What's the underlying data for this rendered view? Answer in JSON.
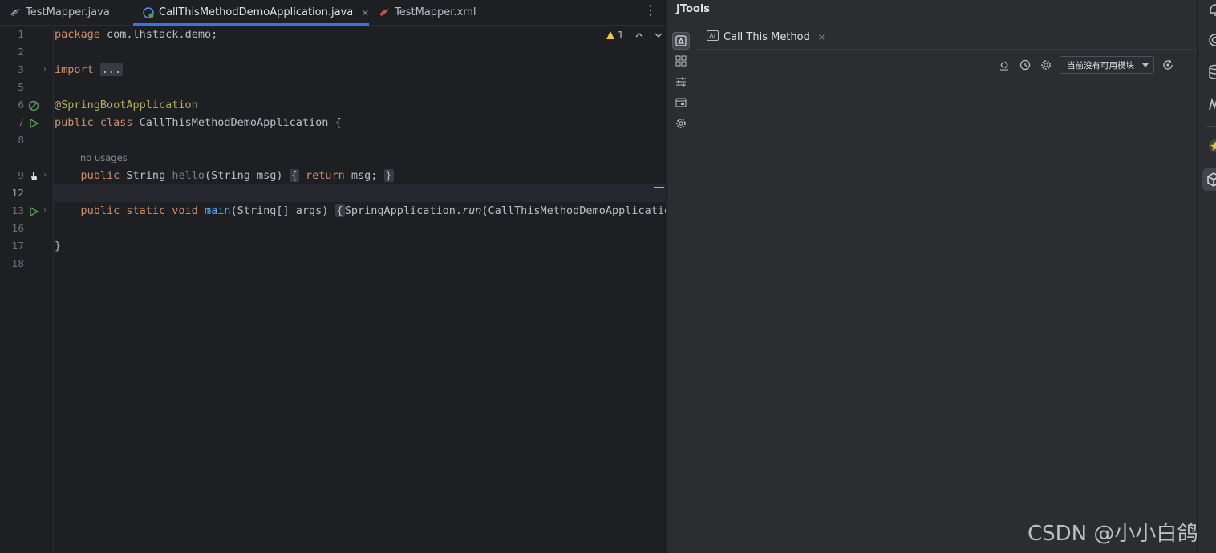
{
  "editor": {
    "tabs": [
      {
        "label": "TestMapper.java",
        "active": false
      },
      {
        "label": "CallThisMethodDemoApplication.java",
        "active": true
      },
      {
        "label": "TestMapper.xml",
        "active": false
      }
    ],
    "more_label": "⋮",
    "inspection": {
      "warning_count": "1"
    },
    "line_numbers": [
      "1",
      "2",
      "3",
      "5",
      "6",
      "7",
      "8",
      "9",
      "12",
      "13",
      "16",
      "17",
      "18"
    ],
    "lines": {
      "l1": {
        "kw": "package",
        "rest": " com.lhstack.demo;"
      },
      "l3": {
        "kw": "import",
        "fold": "..."
      },
      "l6": {
        "ann": "@SpringBootApplication"
      },
      "l7": {
        "kw": "public class",
        "rest": " CallThisMethodDemoApplication {"
      },
      "hint": "no usages",
      "l9": {
        "kw": "public",
        "type": " String ",
        "name": "hello",
        "params": "(String msg)",
        "ob": "{",
        "ret": "return",
        "body": " msg;",
        "cb": "}"
      },
      "l13": {
        "kw": "public static void",
        "name": "main",
        "params": "(String[] args)",
        "ob": "{",
        "call_a": "SpringApplication.",
        "call_b": "run",
        "call_c": "(CallThisMethodDemoApplicatio"
      },
      "l17": {
        "rest": "}"
      }
    }
  },
  "tool": {
    "title": "JTools",
    "tab_label": "Call This Method",
    "tab_close": "×",
    "module_select": "当前没有可用模块",
    "tab_close_editor": "×"
  },
  "watermark": "CSDN @小小白鸽",
  "colors": {
    "accent": "#3574f0",
    "keyword": "#cf8e6d",
    "annotation": "#b3ae60",
    "function": "#56a8f5",
    "warning": "#f2c55c",
    "run": "#57965c"
  }
}
